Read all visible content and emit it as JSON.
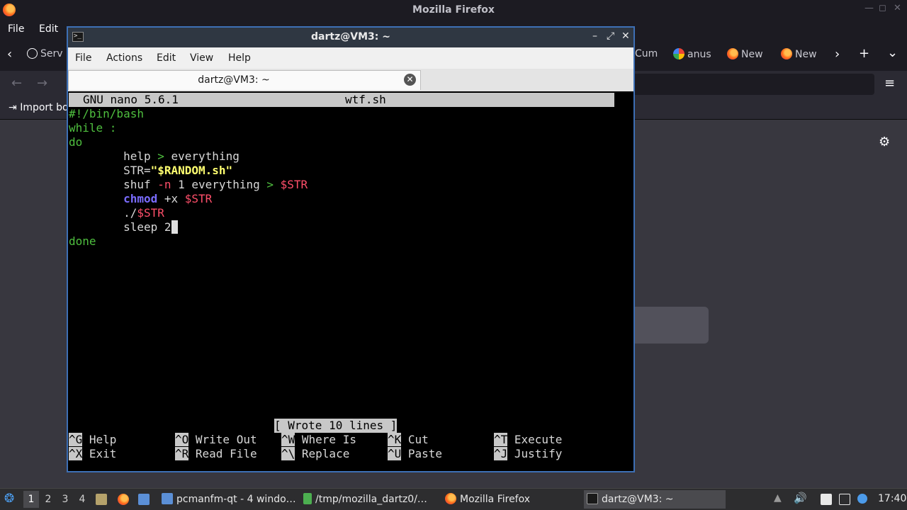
{
  "firefox": {
    "window_title": "Mozilla Firefox",
    "menu": [
      "File",
      "Edit"
    ],
    "tabs": [
      {
        "label": "Serv",
        "icon": "info-icon"
      },
      {
        "label": "Cum",
        "icon": "tab-icon"
      },
      {
        "label": "anus",
        "icon": "google-icon"
      },
      {
        "label": "New",
        "icon": "firefox-icon"
      },
      {
        "label": "New",
        "icon": "firefox-icon"
      }
    ],
    "bookmark": "Import bo"
  },
  "terminal": {
    "title": "dartz@VM3: ~",
    "menu": [
      "File",
      "Actions",
      "Edit",
      "View",
      "Help"
    ],
    "tab_label": "dartz@VM3: ~"
  },
  "nano": {
    "version": "GNU nano 5.6.1",
    "filename": "wtf.sh",
    "lines": {
      "l1": "#!/bin/bash",
      "l2": "while :",
      "l3": "do",
      "l4a": "        help ",
      "l4b": ">",
      "l4c": " everything",
      "l5a": "        STR=",
      "l5b": "\"$RANDOM.sh\"",
      "l6a": "        shuf ",
      "l6b": "-n",
      "l6c": " 1 everything ",
      "l6d": ">",
      "l6e": " ",
      "l6f": "$STR",
      "l7a": "        ",
      "l7b": "chmod",
      "l7c": " +x ",
      "l7d": "$STR",
      "l8a": "        ./",
      "l8b": "$STR",
      "l9a": "        sleep 2",
      "l9b": " ",
      "l10": "done"
    },
    "status": "[ Wrote 10 lines ]",
    "shortcuts": [
      {
        "key": "^G",
        "label": " Help"
      },
      {
        "key": "^O",
        "label": " Write Out"
      },
      {
        "key": "^W",
        "label": " Where Is"
      },
      {
        "key": "^K",
        "label": " Cut"
      },
      {
        "key": "^T",
        "label": " Execute"
      },
      {
        "key": "^X",
        "label": " Exit"
      },
      {
        "key": "^R",
        "label": " Read File"
      },
      {
        "key": "^\\",
        "label": " Replace"
      },
      {
        "key": "^U",
        "label": " Paste"
      },
      {
        "key": "^J",
        "label": " Justify"
      }
    ]
  },
  "taskbar": {
    "desktops": [
      "1",
      "2",
      "3",
      "4"
    ],
    "tasks": [
      {
        "label": "pcmanfm-qt - 4 windo…",
        "icon": "folder-icon"
      },
      {
        "label": "/tmp/mozilla_dartz0/…",
        "icon": "script-icon"
      },
      {
        "label": "Mozilla Firefox",
        "icon": "firefox-icon"
      },
      {
        "label": "dartz@VM3: ~",
        "icon": "terminal-icon"
      }
    ],
    "clock": "17:40"
  }
}
